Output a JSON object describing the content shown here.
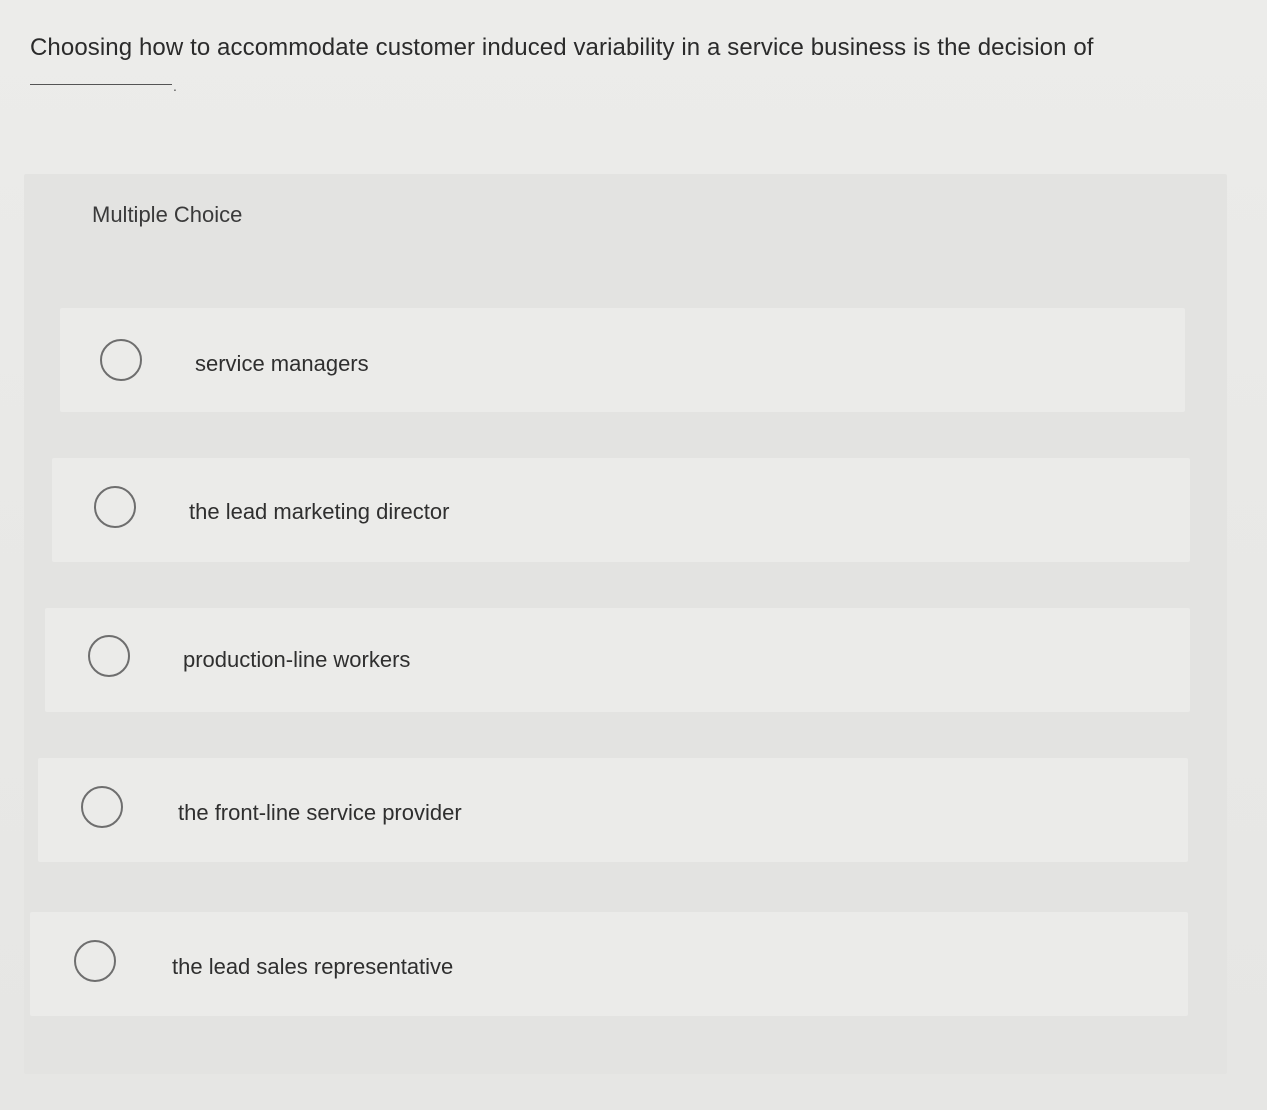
{
  "question": {
    "text": "Choosing how to accommodate customer induced variability in a service business is the decision of",
    "blank_suffix": "."
  },
  "section_label": "Multiple Choice",
  "options": [
    {
      "label": "service managers",
      "selected": false
    },
    {
      "label": "the lead marketing director",
      "selected": false
    },
    {
      "label": "production-line workers",
      "selected": false
    },
    {
      "label": "the front-line service provider",
      "selected": false
    },
    {
      "label": "the lead sales representative",
      "selected": false
    }
  ]
}
